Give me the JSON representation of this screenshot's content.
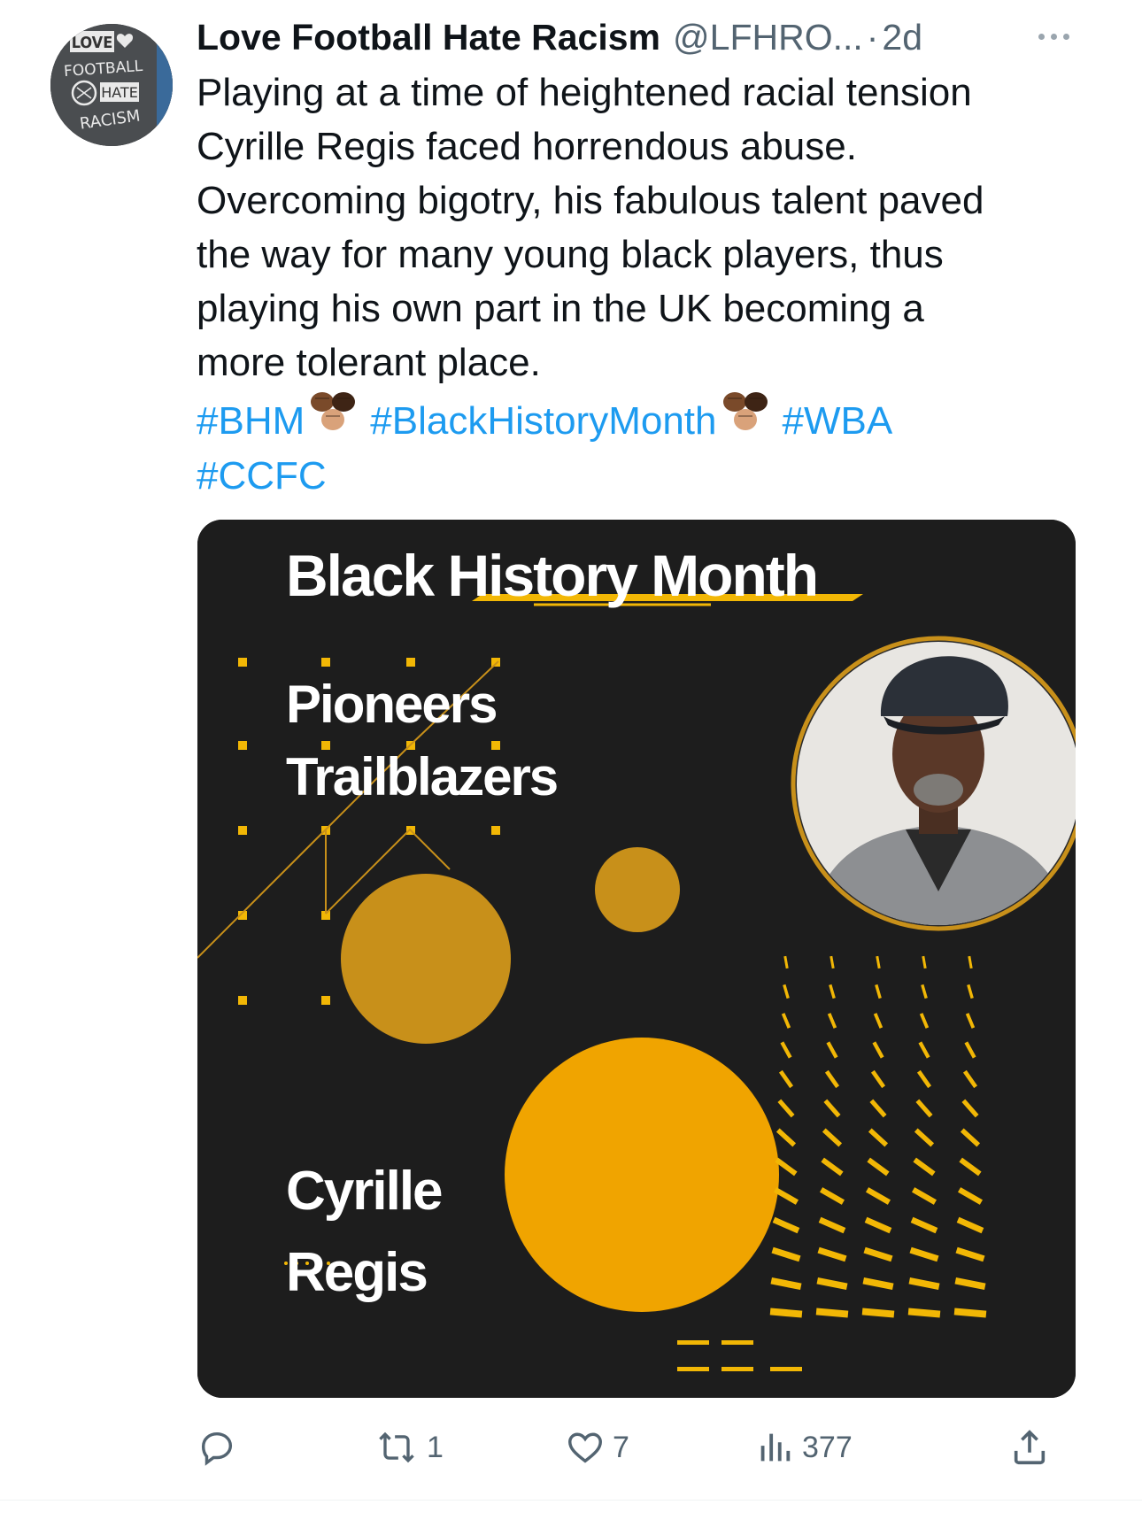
{
  "author": {
    "display_name": "Love Football Hate Racism",
    "handle": "@LFHRO...",
    "separator": "·",
    "time": "2d",
    "avatar_logo_text": [
      "LOVE",
      "FOOTBALL",
      "HATE",
      "RACISM"
    ]
  },
  "tweet": {
    "text_lines": [
      "Playing at a time of heightened racial tension",
      "Cyrille Regis  faced horrendous abuse.",
      "Overcoming bigotry, his fabulous talent paved",
      "the way for many young black players, thus",
      "playing his own part in the UK becoming a",
      "more tolerant place."
    ],
    "hashtags": [
      "#BHM",
      "#BlackHistoryMonth",
      "#WBA",
      "#CCFC"
    ]
  },
  "media": {
    "title": "Black History Month",
    "subtitle_lines": [
      "Pioneers",
      "Trailblazers"
    ],
    "name_lines": [
      "Cyrille",
      "Regis"
    ],
    "colors": {
      "background": "#1d1d1d",
      "gold": "#c8901a",
      "orange": "#f0a400",
      "yellow": "#f2b705"
    }
  },
  "actions": {
    "reply": {
      "icon": "reply-icon",
      "count": ""
    },
    "retweet": {
      "icon": "retweet-icon",
      "count": "1"
    },
    "like": {
      "icon": "heart-icon",
      "count": "7"
    },
    "views": {
      "icon": "views-chart-icon",
      "count": "377"
    },
    "share": {
      "icon": "share-icon"
    }
  },
  "colors": {
    "link": "#1d9bf0",
    "muted": "#536471",
    "text": "#0f1419"
  }
}
